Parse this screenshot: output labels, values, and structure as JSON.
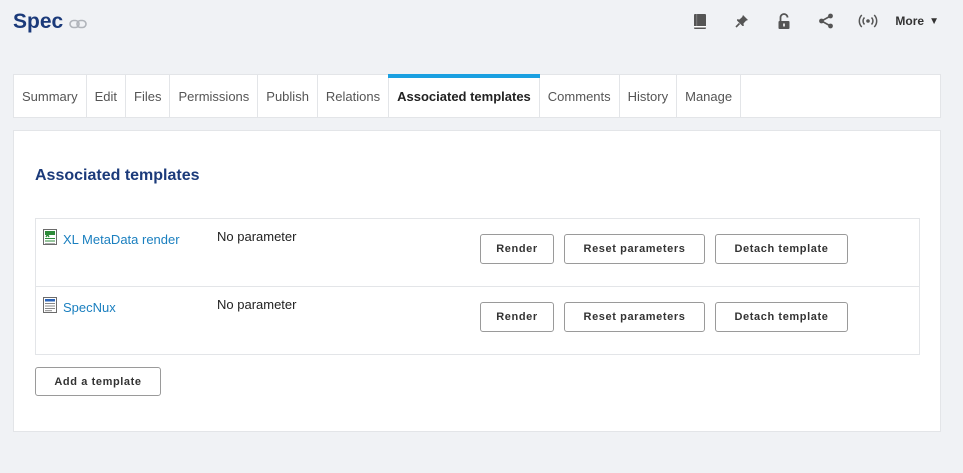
{
  "page": {
    "title": "Spec"
  },
  "toolbar": {
    "icons": [
      "book-icon",
      "pin-icon",
      "unlock-icon",
      "share-icon",
      "broadcast-icon"
    ],
    "more_label": "More",
    "more_caret": "▼"
  },
  "tabs": [
    {
      "label": "Summary",
      "active": false
    },
    {
      "label": "Edit",
      "active": false
    },
    {
      "label": "Files",
      "active": false
    },
    {
      "label": "Permissions",
      "active": false
    },
    {
      "label": "Publish",
      "active": false
    },
    {
      "label": "Relations",
      "active": false
    },
    {
      "label": "Associated templates",
      "active": true
    },
    {
      "label": "Comments",
      "active": false
    },
    {
      "label": "History",
      "active": false
    },
    {
      "label": "Manage",
      "active": false
    }
  ],
  "section": {
    "title": "Associated templates",
    "templates": [
      {
        "name": "XL MetaData render",
        "icon": "spreadsheet-icon",
        "param": "No parameter"
      },
      {
        "name": "SpecNux",
        "icon": "document-icon",
        "param": "No parameter"
      }
    ],
    "buttons": {
      "render": "Render",
      "reset": "Reset parameters",
      "detach": "Detach template"
    },
    "add_label": "Add a template"
  },
  "colors": {
    "title": "#1b3a7a",
    "link": "#1a7fbf",
    "active_tab_accent": "#1aa0e1",
    "background": "#f0f2f5"
  }
}
